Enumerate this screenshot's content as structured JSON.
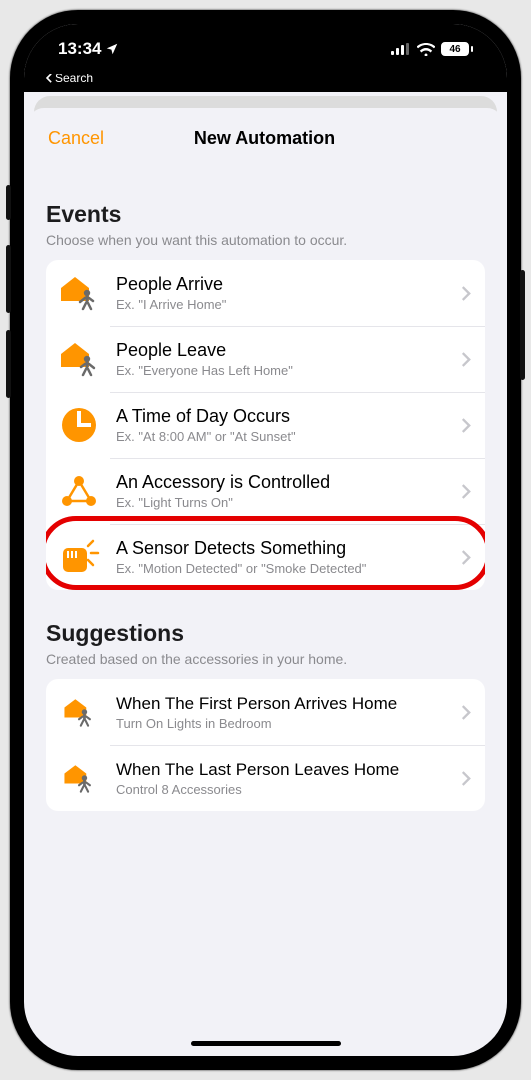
{
  "status": {
    "time": "13:34",
    "back_label": "Search",
    "battery": "46"
  },
  "nav": {
    "cancel": "Cancel",
    "title": "New Automation"
  },
  "events": {
    "title": "Events",
    "subtitle": "Choose when you want this automation to occur.",
    "items": [
      {
        "title": "People Arrive",
        "subtitle": "Ex. \"I Arrive Home\""
      },
      {
        "title": "People Leave",
        "subtitle": "Ex. \"Everyone Has Left Home\""
      },
      {
        "title": "A Time of Day Occurs",
        "subtitle": "Ex. \"At 8:00 AM\" or \"At Sunset\""
      },
      {
        "title": "An Accessory is Controlled",
        "subtitle": "Ex. \"Light Turns On\""
      },
      {
        "title": "A Sensor Detects Something",
        "subtitle": "Ex. \"Motion Detected\" or \"Smoke Detected\""
      }
    ]
  },
  "suggestions": {
    "title": "Suggestions",
    "subtitle": "Created based on the accessories in your home.",
    "items": [
      {
        "title": "When The First Person Arrives Home",
        "subtitle": "Turn On Lights in Bedroom"
      },
      {
        "title": "When The Last Person Leaves Home",
        "subtitle": "Control 8 Accessories"
      }
    ]
  },
  "colors": {
    "accent": "#ff9500",
    "muted": "#8a8a8e"
  }
}
